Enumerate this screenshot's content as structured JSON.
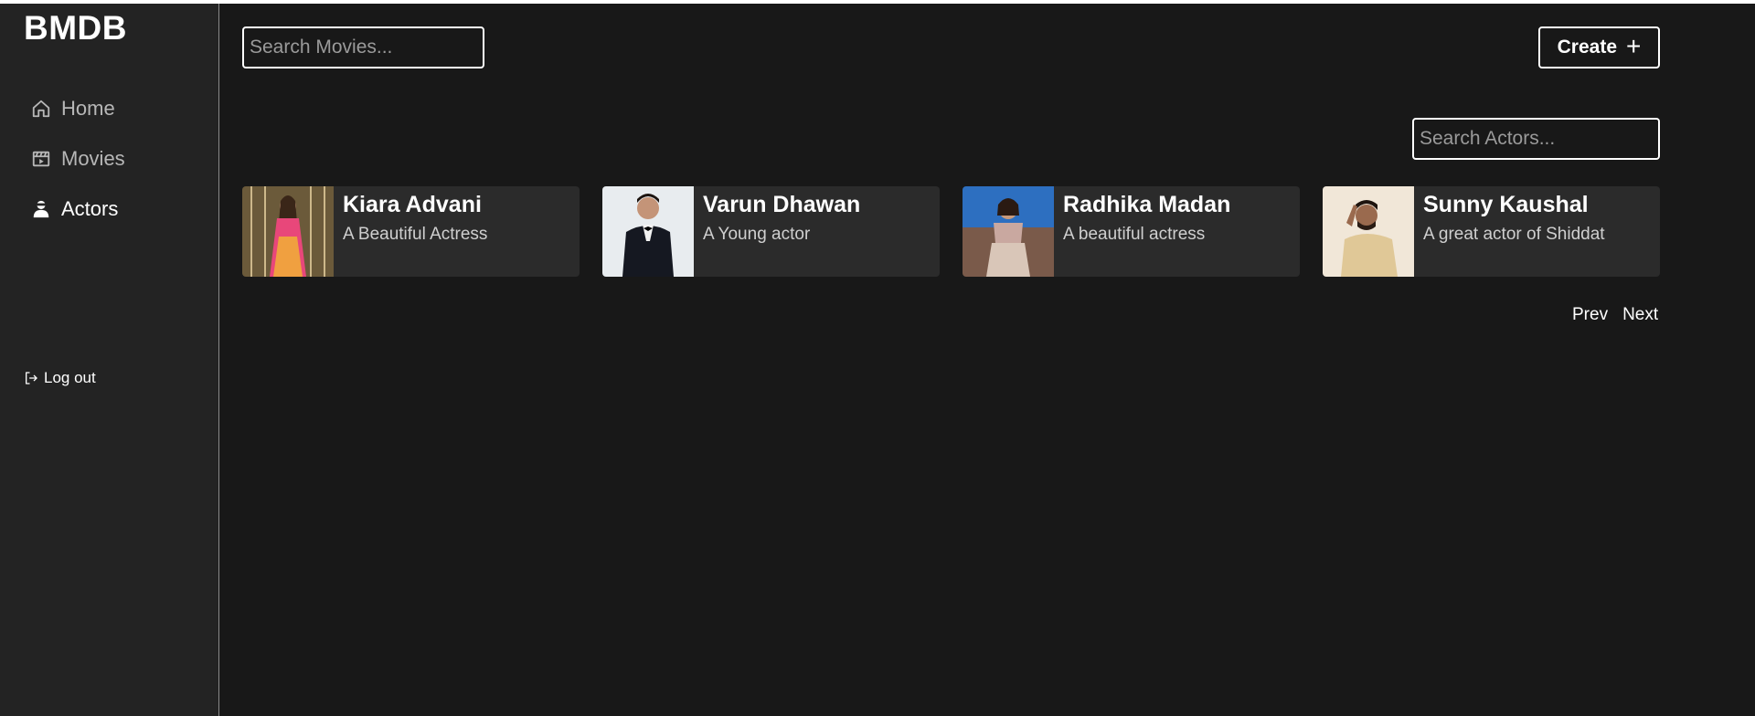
{
  "app": {
    "brand": "BMDB"
  },
  "sidebar": {
    "items": [
      {
        "label": "Home",
        "icon": "home-icon",
        "active": false
      },
      {
        "label": "Movies",
        "icon": "film-icon",
        "active": false
      },
      {
        "label": "Actors",
        "icon": "actor-icon",
        "active": true
      }
    ],
    "logout_label": "Log out"
  },
  "header": {
    "search_movies_placeholder": "Search Movies...",
    "create_label": "Create",
    "create_icon": "plus-icon"
  },
  "actors": {
    "search_placeholder": "Search Actors...",
    "cards": [
      {
        "name": "Kiara Advani",
        "description": "A Beautiful Actress"
      },
      {
        "name": "Varun Dhawan",
        "description": "A Young actor"
      },
      {
        "name": "Radhika Madan",
        "description": "A beautiful actress"
      },
      {
        "name": "Sunny Kaushal",
        "description": "A great actor of Shiddat"
      }
    ]
  },
  "pagination": {
    "prev_label": "Prev",
    "next_label": "Next"
  },
  "colors": {
    "background": "#181818",
    "sidebar": "#232323",
    "card": "#2b2b2b",
    "text": "#ffffff"
  }
}
